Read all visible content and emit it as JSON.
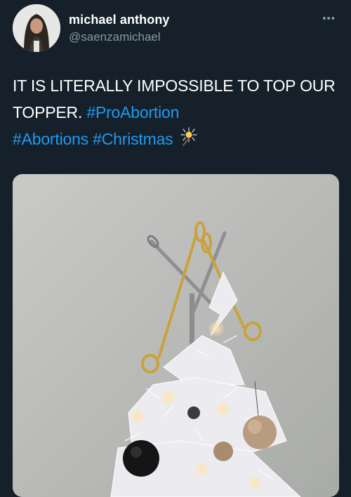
{
  "author": {
    "display_name": "michael anthony",
    "handle": "@saenzamichael",
    "avatar_icon": "profile-photo"
  },
  "menu": {
    "more_label": "•••"
  },
  "tweet": {
    "text": "IT IS LITERALLY IMPOSSIBLE TO TOP OUR TOPPER.",
    "hashtags": [
      "#ProAbortion",
      "#Abortions",
      "#Christmas"
    ],
    "emoji_icon": "sparkler-icon"
  },
  "media": {
    "icon": "christmas-tree-photo"
  },
  "colors": {
    "background": "#15202b",
    "hashtag": "#1d9bf0",
    "secondary_text": "#8b98a5"
  }
}
